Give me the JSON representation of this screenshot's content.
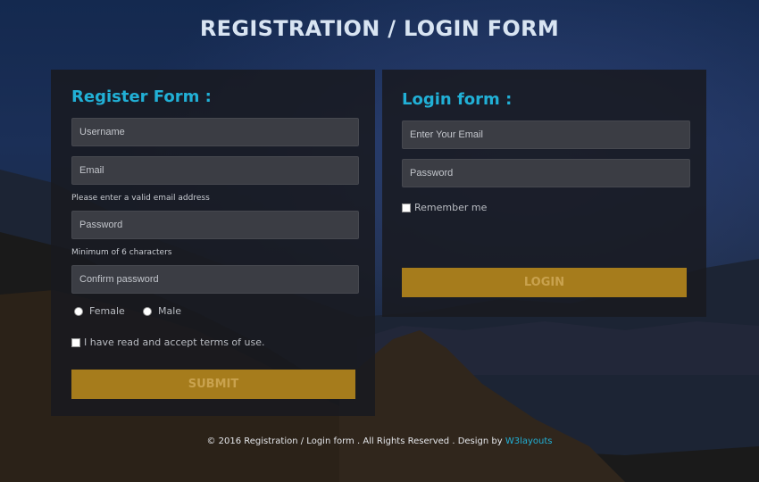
{
  "page": {
    "title": "REGISTRATION / LOGIN FORM"
  },
  "register": {
    "heading": "Register Form :",
    "username_placeholder": "Username",
    "email_placeholder": "Email",
    "email_hint": "Please enter a valid email address",
    "password_placeholder": "Password",
    "password_hint": "Minimum of 6 characters",
    "confirm_placeholder": "Confirm password",
    "gender_options": [
      "Female",
      "Male"
    ],
    "terms_label": "I have read and accept terms of use.",
    "submit_label": "SUBMIT"
  },
  "login": {
    "heading": "Login form :",
    "email_placeholder": "Enter Your Email",
    "password_placeholder": "Password",
    "remember_label": "Remember me",
    "login_label": "LOGIN"
  },
  "footer": {
    "text": "© 2016 Registration / Login form . All Rights Reserved . Design by",
    "link_text": "W3layouts"
  },
  "colors": {
    "accent": "#21b0d6",
    "button": "#a67c1c",
    "panel": "#18191f",
    "field": "#3b3d44"
  }
}
